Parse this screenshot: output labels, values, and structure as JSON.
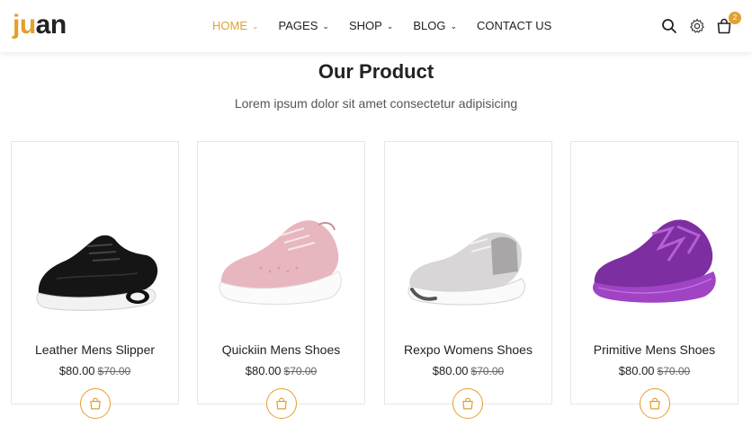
{
  "brand": {
    "logo_part1": "ju",
    "logo_part2": "an",
    "accent_color": "#e2a02e"
  },
  "nav": {
    "items": [
      {
        "label": "HOME",
        "active": true,
        "has_dropdown": true
      },
      {
        "label": "PAGES",
        "active": false,
        "has_dropdown": true
      },
      {
        "label": "SHOP",
        "active": false,
        "has_dropdown": true
      },
      {
        "label": "BLOG",
        "active": false,
        "has_dropdown": true
      },
      {
        "label": "CONTACT US",
        "active": false,
        "has_dropdown": false
      }
    ]
  },
  "header_icons": {
    "search": "search-icon",
    "settings": "gear-icon",
    "cart": "shopping-bag-icon",
    "cart_count": "2"
  },
  "section": {
    "title": "Our Product",
    "subtitle": "Lorem ipsum dolor sit amet consectetur adipisicing"
  },
  "products": [
    {
      "name": "Leather Mens Slipper",
      "price": "$80.00",
      "old_price": "$70.00",
      "color": "black"
    },
    {
      "name": "Quickiin Mens Shoes",
      "price": "$80.00",
      "old_price": "$70.00",
      "color": "pink"
    },
    {
      "name": "Rexpo Womens Shoes",
      "price": "$80.00",
      "old_price": "$70.00",
      "color": "grey"
    },
    {
      "name": "Primitive Mens Shoes",
      "price": "$80.00",
      "old_price": "$70.00",
      "color": "purple"
    }
  ]
}
